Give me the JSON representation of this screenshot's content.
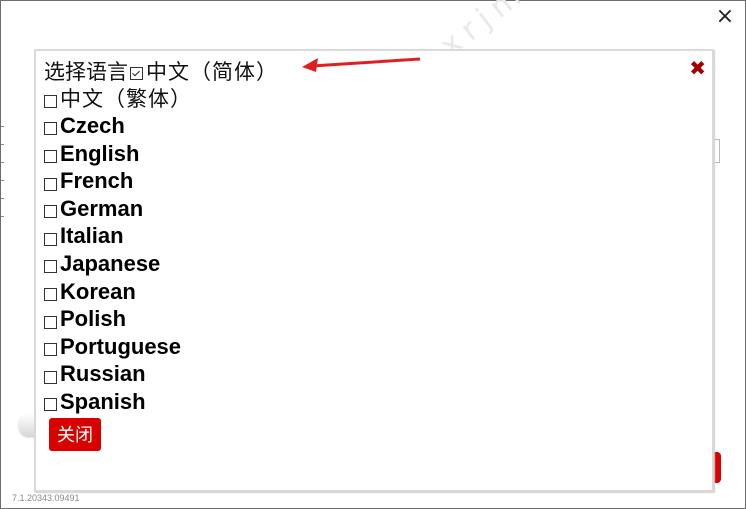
{
  "window": {
    "close_icon": "×",
    "version": "7.1.20343.09491"
  },
  "popup": {
    "title": "选择语言",
    "close_icon": "✖",
    "languages": [
      {
        "label": "中文（简体）",
        "checked": true,
        "script": "cjk"
      },
      {
        "label": "中文（繁体）",
        "checked": false,
        "script": "cjk"
      },
      {
        "label": "Czech",
        "checked": false,
        "script": "latin"
      },
      {
        "label": "English",
        "checked": false,
        "script": "latin"
      },
      {
        "label": "French",
        "checked": false,
        "script": "latin"
      },
      {
        "label": "German",
        "checked": false,
        "script": "latin"
      },
      {
        "label": "Italian",
        "checked": false,
        "script": "latin"
      },
      {
        "label": "Japanese",
        "checked": false,
        "script": "latin"
      },
      {
        "label": "Korean",
        "checked": false,
        "script": "latin"
      },
      {
        "label": "Polish",
        "checked": false,
        "script": "latin"
      },
      {
        "label": "Portuguese",
        "checked": false,
        "script": "latin"
      },
      {
        "label": "Russian",
        "checked": false,
        "script": "latin"
      },
      {
        "label": "Spanish",
        "checked": false,
        "script": "latin"
      }
    ],
    "close_button_label": "关闭"
  },
  "watermark": "小小软件迷 www.xxrjm.com",
  "colors": {
    "accent_red": "#d90000",
    "close_x": "#a00000",
    "arrow": "#e02020"
  }
}
